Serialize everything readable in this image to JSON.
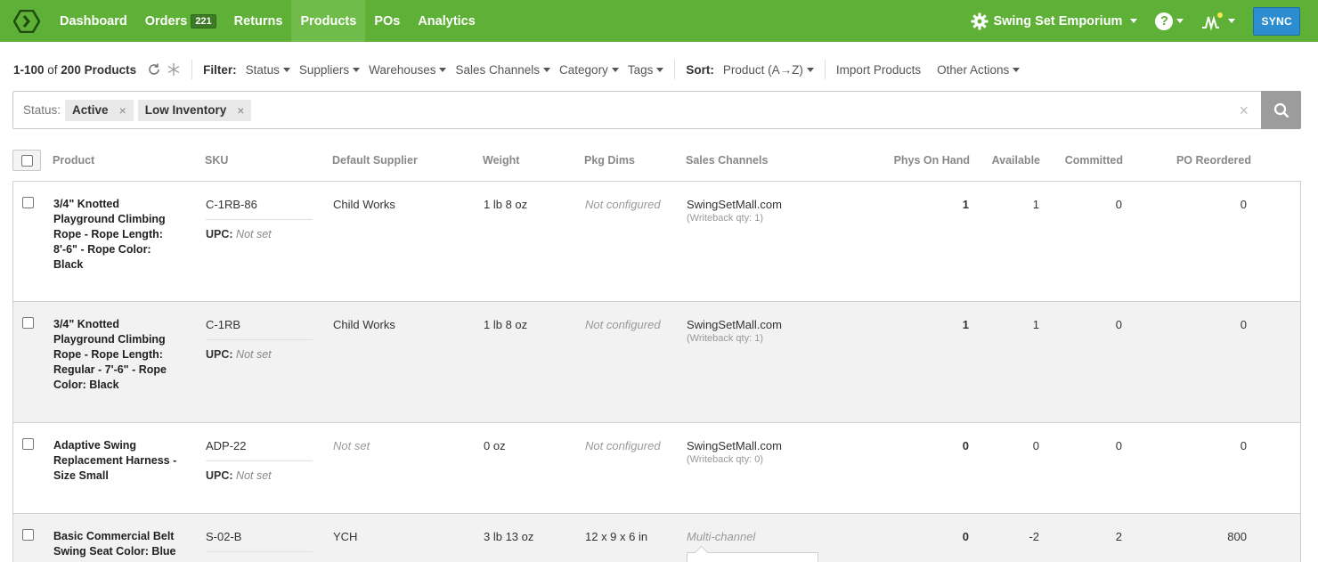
{
  "nav": {
    "items": [
      {
        "label": "Dashboard"
      },
      {
        "label": "Orders",
        "badge": "221"
      },
      {
        "label": "Returns"
      },
      {
        "label": "Products",
        "active": true
      },
      {
        "label": "POs"
      },
      {
        "label": "Analytics"
      }
    ],
    "account_name": "Swing Set Emporium",
    "sync_label": "SYNC",
    "colors": {
      "nav_bg": "#5fb037",
      "active_bg": "#70bc4a",
      "sync_bg": "#2c8ed0"
    }
  },
  "toolbar": {
    "count_range": "1-100",
    "count_of": " of ",
    "count_total": "200 Products",
    "filter_label": "Filter:",
    "filters": [
      "Status",
      "Suppliers",
      "Warehouses",
      "Sales Channels",
      "Category",
      "Tags"
    ],
    "sort_label": "Sort:",
    "sort_value": "Product (A→Z)",
    "import_label": "Import Products",
    "other_actions_label": "Other Actions"
  },
  "filter_bar": {
    "label": "Status:",
    "chips": [
      "Active",
      "Low Inventory"
    ],
    "chip_remove": "×",
    "clear": "×"
  },
  "table": {
    "headers": {
      "product": "Product",
      "sku": "SKU",
      "supplier": "Default Supplier",
      "weight": "Weight",
      "pkg": "Pkg Dims",
      "channels": "Sales Channels",
      "phys": "Phys On Hand",
      "available": "Available",
      "committed": "Committed",
      "po_reordered": "PO Reordered"
    },
    "upc_label": "UPC:",
    "rows": [
      {
        "name": "3/4\" Knotted Playground Climbing Rope - Rope Length: 8'-6\" - Rope Color: Black",
        "sku": "C-1RB-86",
        "upc": "Not set",
        "supplier": "Child Works",
        "weight": "1 lb  8 oz",
        "pkg": "Not configured",
        "channel": "SwingSetMall.com",
        "writeback": "(Writeback qty: 1)",
        "phys": "1",
        "available": "1",
        "committed": "0",
        "po": "0"
      },
      {
        "name": "3/4\" Knotted Playground Climbing Rope - Rope Length: Regular - 7'-6\" - Rope Color: Black",
        "sku": "C-1RB",
        "upc": "Not set",
        "supplier": "Child Works",
        "weight": "1 lb  8 oz",
        "pkg": "Not configured",
        "channel": "SwingSetMall.com",
        "writeback": "(Writeback qty: 1)",
        "phys": "1",
        "available": "1",
        "committed": "0",
        "po": "0"
      },
      {
        "name": "Adaptive Swing Replacement Harness - Size Small",
        "sku": "ADP-22",
        "upc": "Not set",
        "supplier": "Not set",
        "weight": "0 oz",
        "pkg": "Not configured",
        "channel": "SwingSetMall.com",
        "writeback": "(Writeback qty: 0)",
        "phys": "0",
        "available": "0",
        "committed": "0",
        "po": "0"
      },
      {
        "name": "Basic Commercial Belt Swing Seat Color: Blue",
        "sku": "S-02-B",
        "supplier": "YCH",
        "weight": "3 lb  13 oz",
        "pkg": "12 x 9 x 6 in",
        "channel": "Multi-channel",
        "phys": "0",
        "available": "-2",
        "committed": "2",
        "po": "800"
      }
    ]
  }
}
